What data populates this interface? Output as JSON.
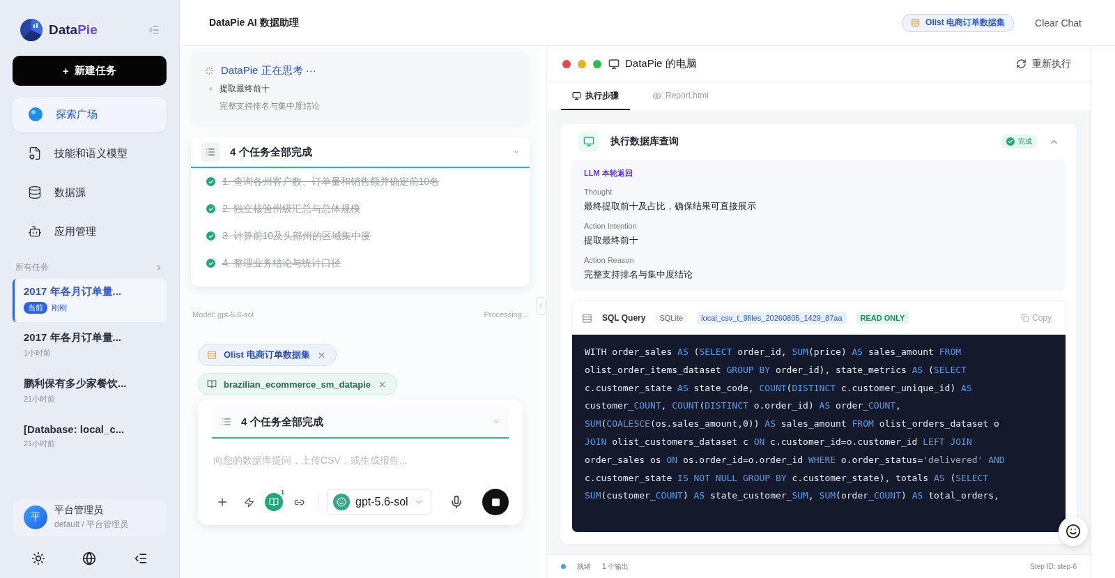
{
  "sidebar": {
    "logo": {
      "part_a": "Data",
      "part_b": "Pie"
    },
    "new_task": {
      "icon": "+",
      "label": "新建任务"
    },
    "nav": [
      {
        "label": "探索广场",
        "selected": true
      },
      {
        "label": "技能和语义模型",
        "selected": false
      },
      {
        "label": "数据源",
        "selected": false
      },
      {
        "label": "应用管理",
        "selected": false
      }
    ],
    "section_title": "所有任务",
    "tasks": [
      {
        "title": "2017 年各月订单量...",
        "badge": "当前",
        "time": "刚刚",
        "selected": true
      },
      {
        "title": "2017 年各月订单量...",
        "time": "1小时前",
        "selected": false
      },
      {
        "title": "鹏利保有多少家餐饮...",
        "time": "21小时前",
        "selected": false
      },
      {
        "title": "[Database: local_c...",
        "time": "21小时前",
        "selected": false
      }
    ],
    "user": {
      "avatar": "平",
      "name": "平台管理员",
      "role": "default / 平台管理员"
    }
  },
  "header": {
    "title": "DataPie AI 数据助理",
    "dataset": "Olist 电商订单数据集",
    "clear": "Clear Chat"
  },
  "chat": {
    "thinking": {
      "title": "DataPie 正在思考 ···",
      "step": "提取最终前十",
      "detail": "完整支持排名与集中度结论"
    },
    "plan": {
      "title": "4 个任务全部完成",
      "tasks": [
        {
          "label": "1. 查询各州客户数、订单量和销售额并确定前10名",
          "done": true
        },
        {
          "label": "2. 独立核验州级汇总与总体规模",
          "done": true
        },
        {
          "label": "3. 计算前10及头部州的区域集中度",
          "done": true
        },
        {
          "label": "4. 整理业务结论与统计口径",
          "done": true
        }
      ]
    },
    "model": "Model: gpt-5.6-sol",
    "status": "Processing...",
    "chips": [
      {
        "label": "Olist 电商订单数据集",
        "kind": "dataset"
      },
      {
        "label": "brazilian_ecommerce_sm_datapie",
        "kind": "semantic"
      }
    ],
    "composer": {
      "plan_title": "4 个任务全部完成",
      "placeholder": "向您的数据库提问，上传CSV，或生成报告...",
      "badge": "1",
      "model": "gpt-5.6-sol"
    }
  },
  "computer": {
    "title": "DataPie 的电脑",
    "rerun": "重新执行",
    "tabs": [
      {
        "label": "执行步骤",
        "selected": true
      },
      {
        "label": "Report.html",
        "selected": false
      }
    ],
    "step": {
      "title": "执行数据库查询",
      "status": "完成",
      "expanded": true,
      "llm_label": "LLM 本轮返回",
      "fields": [
        {
          "label": "Thought",
          "value": "最终提取前十及占比，确保结果可直接展示"
        },
        {
          "label": "Action Intention",
          "value": "提取最终前十"
        },
        {
          "label": "Action Reason",
          "value": "完整支持排名与集中度结论"
        }
      ],
      "sql": {
        "title": "SQL Query",
        "engine": "SQLite",
        "source": "local_csv_t_9files_20260805_1429_87aa",
        "mode": "READ ONLY",
        "copy": "Copy",
        "lines": [
          [
            {
              "text": "WITH order_sales ",
              "kind": "id"
            },
            {
              "text": "AS",
              "kind": "kw"
            },
            {
              "text": " (",
              "kind": "id"
            },
            {
              "text": "SELECT",
              "kind": "kw"
            },
            {
              "text": " order_id, ",
              "kind": "id"
            },
            {
              "text": "SUM",
              "kind": "kw"
            },
            {
              "text": "(price) ",
              "kind": "id"
            },
            {
              "text": "AS",
              "kind": "kw"
            },
            {
              "text": " sales_amount ",
              "kind": "id"
            },
            {
              "text": "FROM",
              "kind": "kw"
            }
          ],
          [
            {
              "text": "olist_order_items_dataset ",
              "kind": "id"
            },
            {
              "text": "GROUP BY",
              "kind": "kw"
            },
            {
              "text": " order_id), state_metrics ",
              "kind": "id"
            },
            {
              "text": "AS",
              "kind": "kw"
            },
            {
              "text": " (",
              "kind": "id"
            },
            {
              "text": "SELECT",
              "kind": "kw"
            }
          ],
          [
            {
              "text": "c.customer_state ",
              "kind": "id"
            },
            {
              "text": "AS",
              "kind": "kw"
            },
            {
              "text": " state_code, ",
              "kind": "id"
            },
            {
              "text": "COUNT",
              "kind": "kw"
            },
            {
              "text": "(",
              "kind": "id"
            },
            {
              "text": "DISTINCT",
              "kind": "kw"
            },
            {
              "text": " c.customer_unique_id) ",
              "kind": "id"
            },
            {
              "text": "AS",
              "kind": "kw"
            }
          ],
          [
            {
              "text": "customer_",
              "kind": "id"
            },
            {
              "text": "COUNT",
              "kind": "kw"
            },
            {
              "text": ", ",
              "kind": "id"
            },
            {
              "text": "COUNT",
              "kind": "kw"
            },
            {
              "text": "(",
              "kind": "id"
            },
            {
              "text": "DISTINCT",
              "kind": "kw"
            },
            {
              "text": " o.order_id) ",
              "kind": "id"
            },
            {
              "text": "AS",
              "kind": "kw"
            },
            {
              "text": " order_",
              "kind": "id"
            },
            {
              "text": "COUNT",
              "kind": "kw"
            },
            {
              "text": ",",
              "kind": "id"
            }
          ],
          [
            {
              "text": "SUM",
              "kind": "kw"
            },
            {
              "text": "(",
              "kind": "id"
            },
            {
              "text": "COALESCE",
              "kind": "kw"
            },
            {
              "text": "(os.sales_amount,0)) ",
              "kind": "id"
            },
            {
              "text": "AS",
              "kind": "kw"
            },
            {
              "text": " sales_amount ",
              "kind": "id"
            },
            {
              "text": "FROM",
              "kind": "kw"
            },
            {
              "text": " olist_orders_dataset o",
              "kind": "id"
            }
          ],
          [
            {
              "text": "JOIN",
              "kind": "kw"
            },
            {
              "text": " olist_customers_dataset c ",
              "kind": "id"
            },
            {
              "text": "ON",
              "kind": "kw"
            },
            {
              "text": " c.customer_id=o.customer_id ",
              "kind": "id"
            },
            {
              "text": "LEFT JOIN",
              "kind": "kw"
            }
          ],
          [
            {
              "text": "order_sales os ",
              "kind": "id"
            },
            {
              "text": "ON",
              "kind": "kw"
            },
            {
              "text": " os.order_id=o.order_id ",
              "kind": "id"
            },
            {
              "text": "WHERE",
              "kind": "kw"
            },
            {
              "text": " o.order_status=",
              "kind": "id"
            },
            {
              "text": "'delivered'",
              "kind": "str"
            },
            {
              "text": " AND",
              "kind": "kw"
            }
          ],
          [
            {
              "text": "c.customer_state ",
              "kind": "id"
            },
            {
              "text": "IS NOT NULL",
              "kind": "kw"
            },
            {
              "text": " GROUP BY",
              "kind": "kw"
            },
            {
              "text": " c.customer_state), totals ",
              "kind": "id"
            },
            {
              "text": "AS",
              "kind": "kw"
            },
            {
              "text": " (",
              "kind": "id"
            },
            {
              "text": "SELECT",
              "kind": "kw"
            }
          ],
          [
            {
              "text": "SUM",
              "kind": "kw"
            },
            {
              "text": "(customer_",
              "kind": "id"
            },
            {
              "text": "COUNT",
              "kind": "kw"
            },
            {
              "text": ") ",
              "kind": "id"
            },
            {
              "text": "AS",
              "kind": "kw"
            },
            {
              "text": " state_customer_",
              "kind": "id"
            },
            {
              "text": "SUM",
              "kind": "kw"
            },
            {
              "text": ", ",
              "kind": "id"
            },
            {
              "text": "SUM",
              "kind": "kw"
            },
            {
              "text": "(order_",
              "kind": "id"
            },
            {
              "text": "COUNT",
              "kind": "kw"
            },
            {
              "text": ") ",
              "kind": "id"
            },
            {
              "text": "AS",
              "kind": "kw"
            },
            {
              "text": " total_orders,",
              "kind": "id"
            }
          ]
        ]
      }
    },
    "status": {
      "state": "就绪",
      "outputs": "1 个输出",
      "step_id": "Step ID: step-6"
    }
  }
}
